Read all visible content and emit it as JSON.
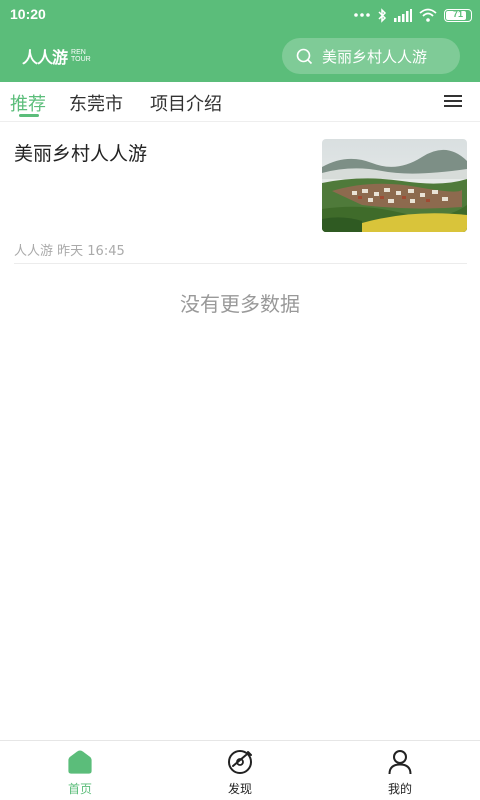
{
  "status_bar": {
    "time": "10:20",
    "battery": "71"
  },
  "header": {
    "logo_cn": "人人游",
    "logo_en_line1": "REN",
    "logo_en_line2": "TOUR",
    "search_placeholder": "美丽乡村人人游"
  },
  "tabs": [
    {
      "label": "推荐",
      "active": true
    },
    {
      "label": "东莞市",
      "active": false
    },
    {
      "label": "项目介绍",
      "active": false
    }
  ],
  "articles": [
    {
      "title": "美丽乡村人人游",
      "source": "人人游",
      "time": "昨天 16:45"
    }
  ],
  "no_more_text": "没有更多数据",
  "bottom_nav": [
    {
      "label": "首页",
      "icon": "home-icon",
      "active": true
    },
    {
      "label": "发现",
      "icon": "discover-icon",
      "active": false
    },
    {
      "label": "我的",
      "icon": "profile-icon",
      "active": false
    }
  ],
  "colors": {
    "primary": "#5bbd7a",
    "text": "#222222",
    "muted": "#aaaaaa"
  }
}
